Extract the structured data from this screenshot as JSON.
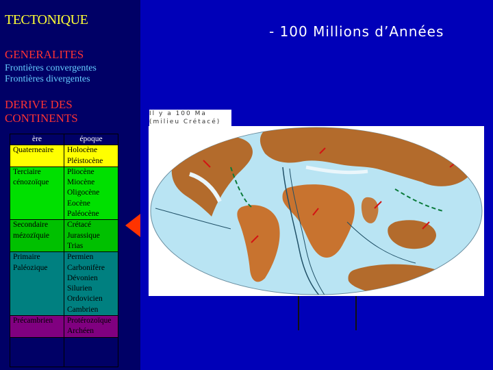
{
  "sidebar": {
    "title": "TECTONIQUE",
    "generalites": "GENERALITES",
    "convergentes": "Frontières convergentes",
    "divergentes": "Frontières divergentes",
    "derive": "DERIVE DES CONTINENTS"
  },
  "timescale": {
    "header_ere": "ère",
    "header_epoque": "époque",
    "rows": [
      {
        "era": "Quaterneaire",
        "epochs": "Holocène\nPléistocène"
      },
      {
        "era": "Terciaire\ncénozoïque",
        "epochs": "Pliocène\nMiocène\nOligocène\nEocène\nPaléocène"
      },
      {
        "era": "Secondaire\nmézozïquie",
        "epochs": "Crétacé\nJurassique\nTrias"
      },
      {
        "era": "Primaire\nPaléozique",
        "epochs": "Permien\nCarbonifère\nDévonien\nSilurien\nOrdovicien\nCambrien"
      },
      {
        "era": "Précambrien",
        "epochs": "Protérozoïque\nArchéen"
      }
    ]
  },
  "main": {
    "heading": "-  100 Millions d’Années",
    "map_caption": "Il y a 100 Ma\n(milieu Crétacé)"
  },
  "colors": {
    "accent_title": "#ffff33",
    "section_red": "#ff3333",
    "link_blue": "#66ccff",
    "arrow_red": "#ff3300"
  }
}
